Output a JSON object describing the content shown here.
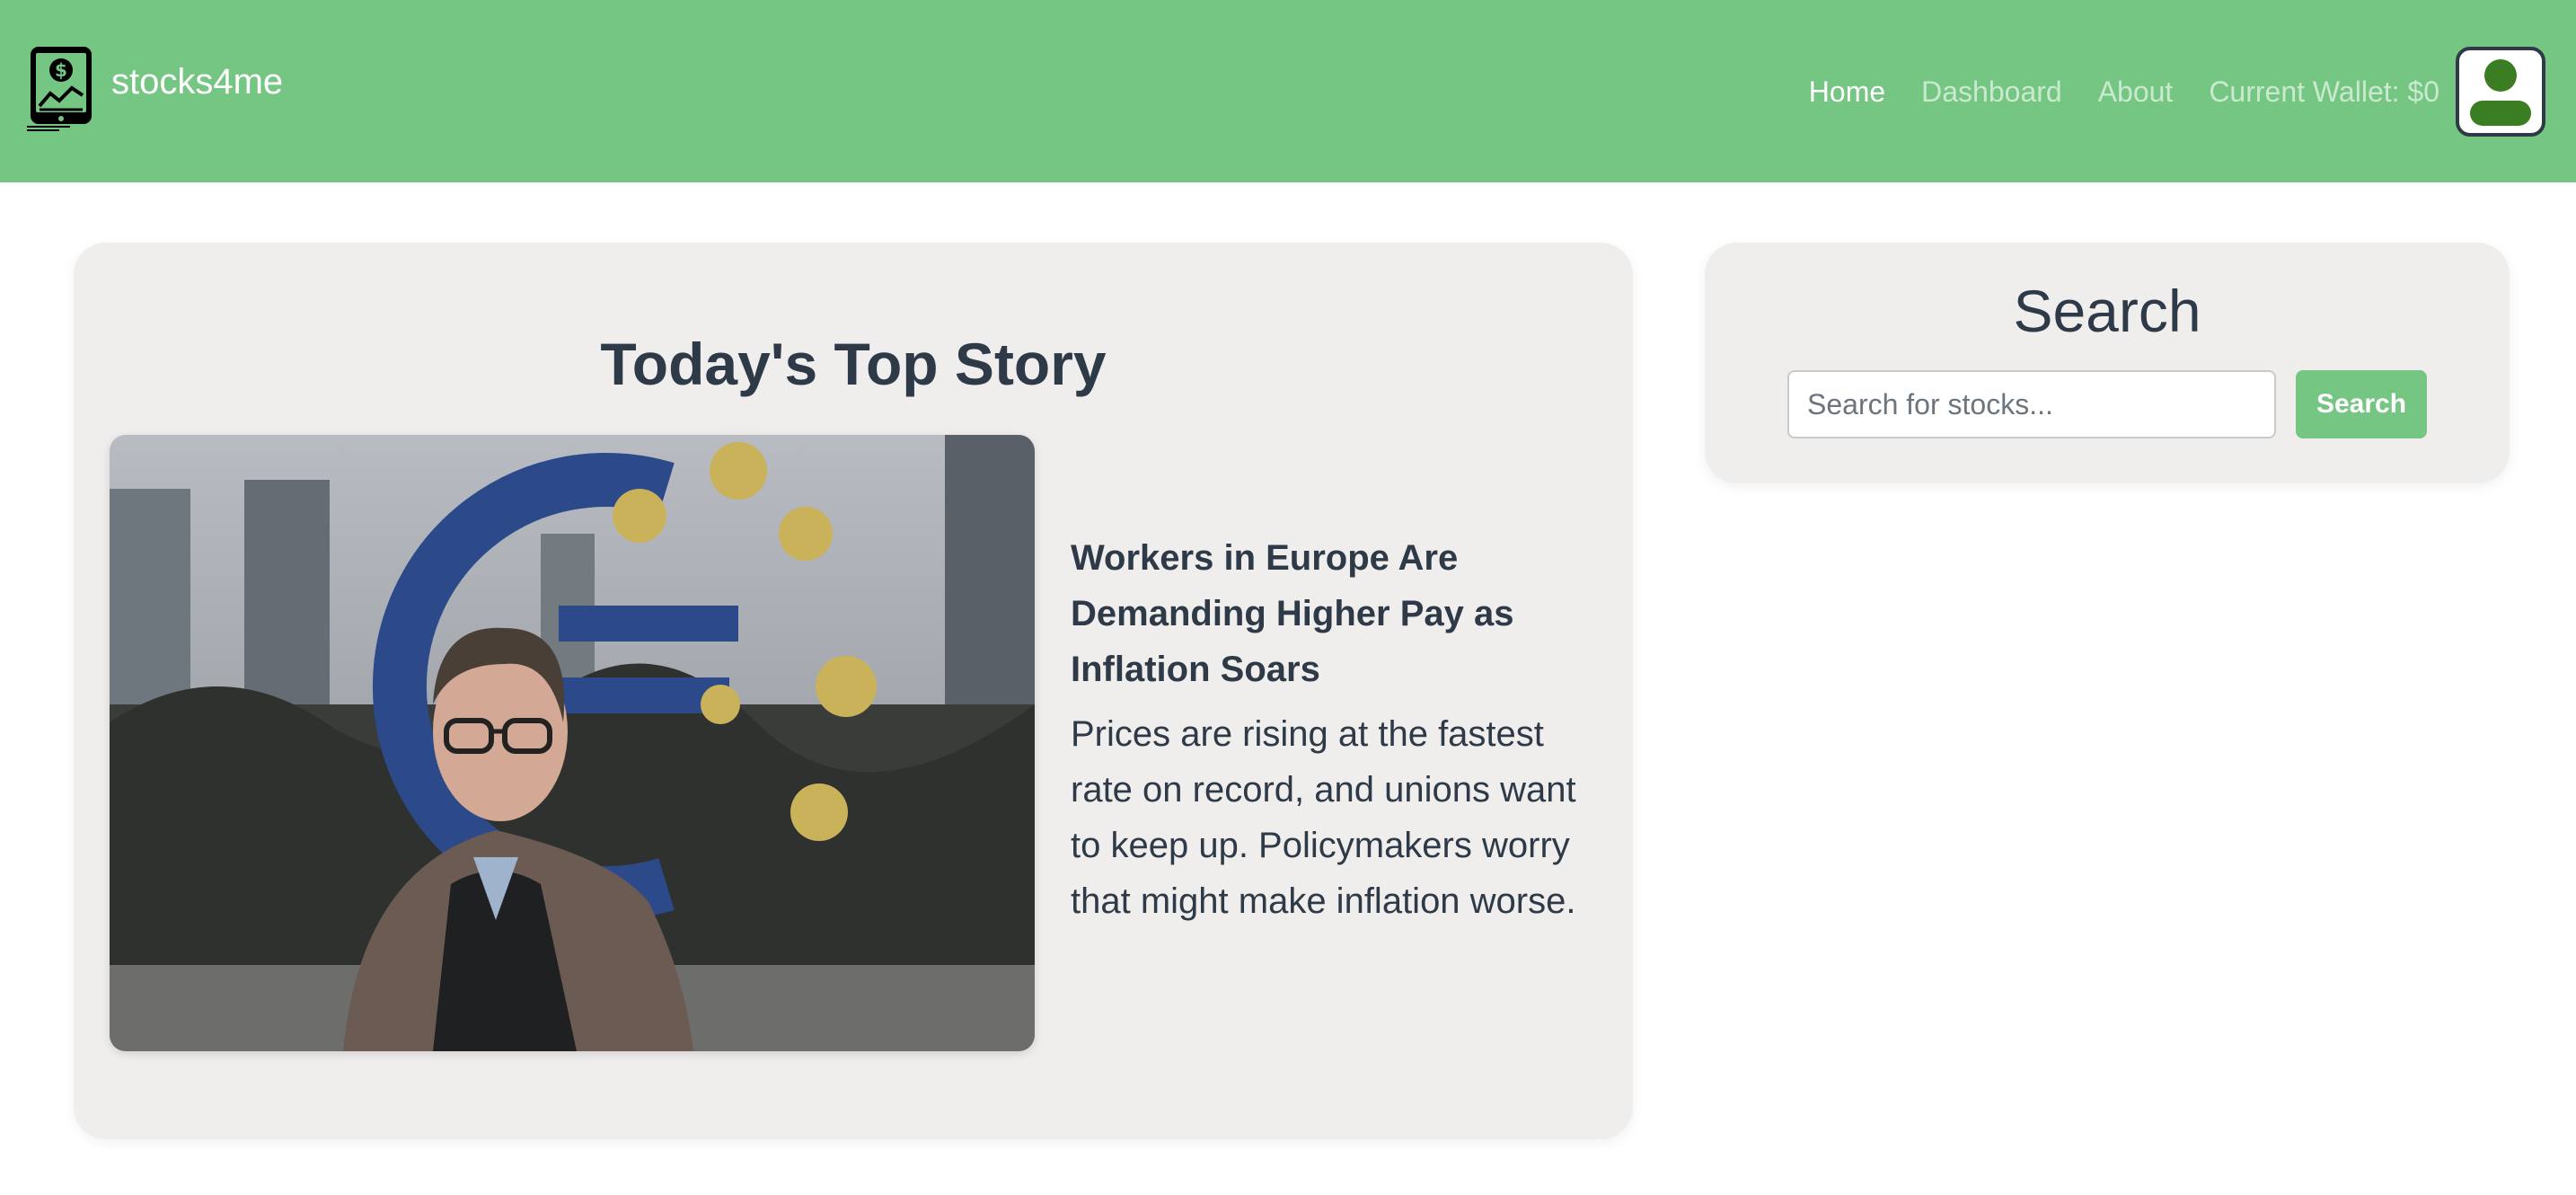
{
  "navbar": {
    "brand_name": "stocks4me",
    "links": [
      {
        "label": "Home",
        "active": true
      },
      {
        "label": "Dashboard",
        "active": false
      },
      {
        "label": "About",
        "active": false
      },
      {
        "label": "Current Wallet: $0",
        "active": false
      }
    ],
    "logo_icon": "tablet-dollar-chart-icon",
    "avatar_icon": "user-avatar-icon"
  },
  "top_story": {
    "heading": "Today's Top Story",
    "title": "Workers in Europe Are Demanding Higher Pay as Inflation Soars",
    "summary": "Prices are rising at the fastest rate on record, and unions want to keep up. Policymakers worry that might make inflation worse."
  },
  "search": {
    "heading": "Search",
    "placeholder": "Search for stocks...",
    "button_label": "Search"
  },
  "colors": {
    "navbar": "#74c682",
    "card": "#efeeec",
    "text": "#2e3a48",
    "avatar_accent": "#3a7d23"
  }
}
